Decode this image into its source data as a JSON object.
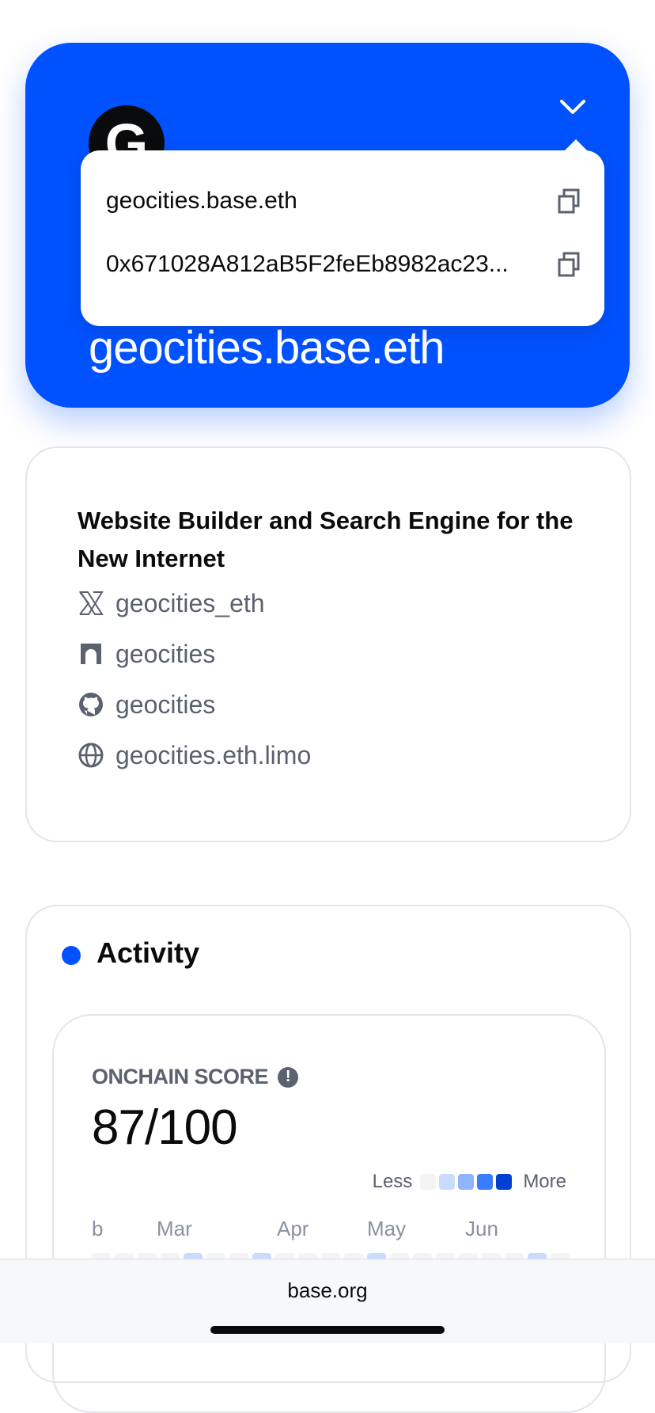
{
  "profile": {
    "avatar_letter": "G",
    "name": "geocities.base.eth",
    "accent_color": "#0052ff",
    "dropdown": {
      "name": "geocities.base.eth",
      "address": "0x671028A812aB5F2feEb8982ac23..."
    }
  },
  "bio": {
    "description": "Website Builder and Search Engine for the New Internet",
    "links": [
      {
        "icon": "x-icon",
        "label": "geocities_eth"
      },
      {
        "icon": "farcaster-icon",
        "label": "geocities"
      },
      {
        "icon": "github-icon",
        "label": "geocities"
      },
      {
        "icon": "globe-icon",
        "label": "geocities.eth.limo"
      }
    ]
  },
  "activity": {
    "title": "Activity",
    "score_label": "ONCHAIN SCORE",
    "score": "87/100",
    "legend_less": "Less",
    "legend_more": "More",
    "months": [
      "b",
      "Mar",
      "Apr",
      "May",
      "Jun"
    ],
    "heatmap_colors": [
      "#f3f4f6",
      "#c9dcff",
      "#8fb4ff",
      "#3a7bff",
      "#0040cc"
    ]
  },
  "browser": {
    "url": "base.org"
  }
}
